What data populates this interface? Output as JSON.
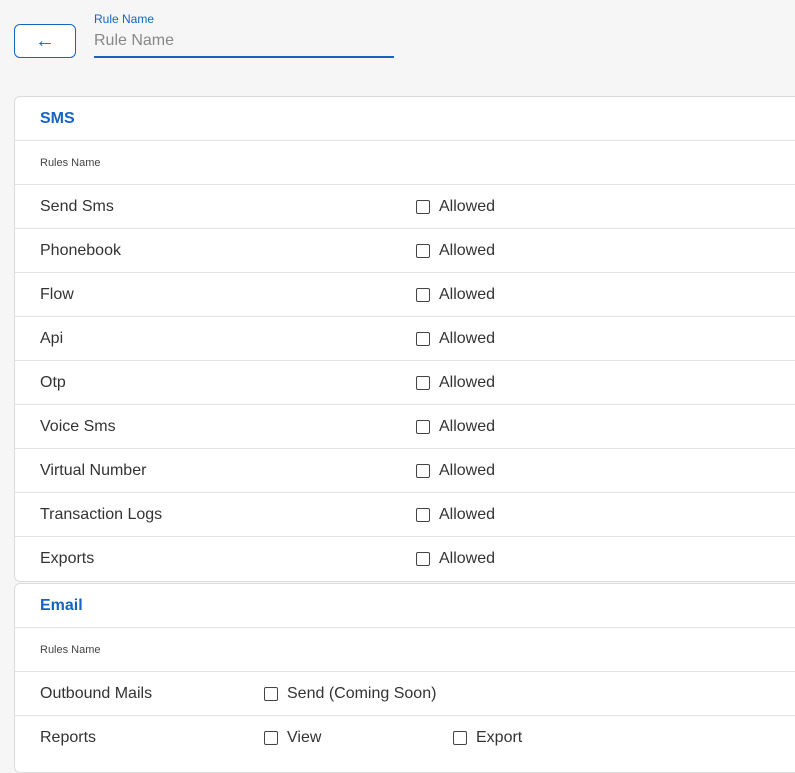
{
  "header": {
    "back_icon": "←",
    "rule_name_label": "Rule Name",
    "rule_name_placeholder": "Rule Name",
    "rule_name_value": ""
  },
  "sms": {
    "title": "SMS",
    "column_header": "Rules Name",
    "rows": [
      {
        "name": "Send Sms",
        "option": "Allowed",
        "checked": false
      },
      {
        "name": "Phonebook",
        "option": "Allowed",
        "checked": false
      },
      {
        "name": "Flow",
        "option": "Allowed",
        "checked": false
      },
      {
        "name": "Api",
        "option": "Allowed",
        "checked": false
      },
      {
        "name": "Otp",
        "option": "Allowed",
        "checked": false
      },
      {
        "name": "Voice Sms",
        "option": "Allowed",
        "checked": false
      },
      {
        "name": "Virtual Number",
        "option": "Allowed",
        "checked": false
      },
      {
        "name": "Transaction Logs",
        "option": "Allowed",
        "checked": false
      },
      {
        "name": "Exports",
        "option": "Allowed",
        "checked": false
      }
    ]
  },
  "email": {
    "title": "Email",
    "column_header": "Rules Name",
    "rows": [
      {
        "name": "Outbound Mails",
        "options": [
          "Send (Coming Soon)"
        ]
      },
      {
        "name": "Reports",
        "options": [
          "View",
          "Export"
        ]
      }
    ]
  },
  "colors": {
    "accent": "#1565c0",
    "border": "#dcdcdc",
    "background": "#f6f6f6"
  }
}
